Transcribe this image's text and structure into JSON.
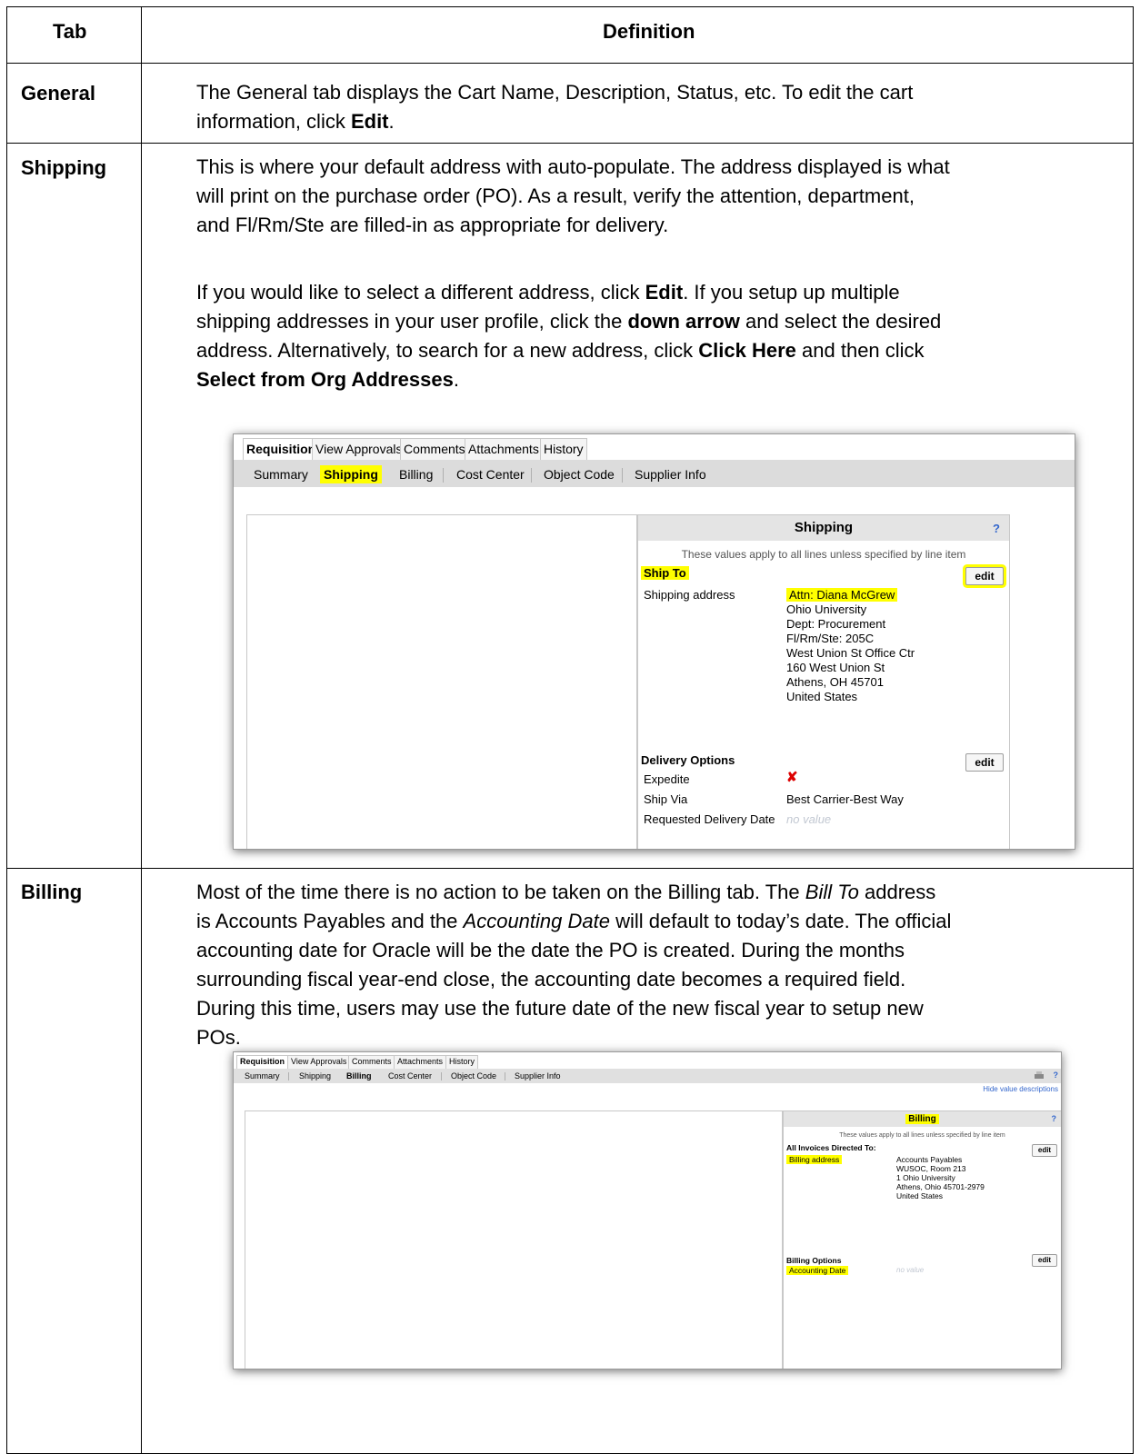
{
  "table": {
    "header_tab": "Tab",
    "header_definition": "Definition",
    "rows": {
      "general": {
        "label": "General",
        "line1": "The General tab displays the Cart Name, Description, Status, etc. To edit the cart",
        "line2_pre": "information, click ",
        "line2_bold": "Edit",
        "line2_post": "."
      },
      "shipping": {
        "label": "Shipping",
        "p1_l1": "This is where your default address with auto-populate. The address displayed is what",
        "p1_l2": "will print on the purchase order (PO). As a result, verify the attention, department,",
        "p1_l3": "and Fl/Rm/Ste are filled-in as appropriate for delivery.",
        "p2_l1_pre": "If you would like to select a different address, click ",
        "p2_l1_b": "Edit",
        "p2_l1_post": ". If you setup up multiple",
        "p2_l2_pre": "shipping addresses in your user profile, click the ",
        "p2_l2_b": "down arrow",
        "p2_l2_post": " and select the desired",
        "p2_l3_pre": "address. Alternatively, to search for a new address, click ",
        "p2_l3_b": "Click Here",
        "p2_l3_post": " and then click",
        "p2_l4_b": "Select from Org Addresses",
        "p2_l4_post": "."
      },
      "billing": {
        "label": "Billing",
        "l1_pre": "Most of the time there is no action to be taken on the Billing tab. The ",
        "l1_i": "Bill To",
        "l1_post": " address",
        "l2_pre": "is Accounts Payables and the ",
        "l2_i": "Accounting Date",
        "l2_post": " will default to today’s date. The official",
        "l3": "accounting date for Oracle will be the date the PO is created. During the months",
        "l4": "surrounding fiscal year-end close, the accounting date becomes a required field.",
        "l5": "During this time, users may use the future date of the new fiscal year to setup new",
        "l6": "POs."
      }
    }
  },
  "screenshot_shipping": {
    "top_tabs": [
      "Requisition",
      "View Approvals",
      "Comments",
      "Attachments",
      "History"
    ],
    "sub_tabs": [
      "Summary",
      "Shipping",
      "Billing",
      "Cost Center",
      "Object Code",
      "Supplier Info"
    ],
    "panel_title": "Shipping",
    "help": "?",
    "note": "These values apply to all lines unless specified by line item",
    "ship_to": "Ship To",
    "shipping_address_label": "Shipping address",
    "address_lines": [
      "Attn: Diana McGrew",
      "Ohio University",
      "Dept: Procurement",
      "Fl/Rm/Ste: 205C",
      "West Union St Office Ctr",
      "160 West Union St",
      "Athens, OH 45701",
      "United States"
    ],
    "edit": "edit",
    "delivery_options": "Delivery Options",
    "expedite": "Expedite",
    "expedite_value": "✘",
    "ship_via": "Ship Via",
    "ship_via_value": "Best Carrier-Best Way",
    "requested_delivery_date": "Requested Delivery Date",
    "no_value": "no value"
  },
  "screenshot_billing": {
    "top_tabs": [
      "Requisition",
      "View Approvals",
      "Comments",
      "Attachments",
      "History"
    ],
    "sub_tabs": [
      "Summary",
      "Shipping",
      "Billing",
      "Cost Center",
      "Object Code",
      "Supplier Info"
    ],
    "hide_link": "Hide value descriptions",
    "panel_title": "Billing",
    "help": "?",
    "note": "These values apply to all lines unless specified by line item",
    "invoices": "All Invoices Directed To:",
    "billing_address_label": "Billing address",
    "address_lines": [
      "Accounts Payables",
      "WUSOC, Room 213",
      "1 Ohio University",
      "Athens, Ohio 45701-2979",
      "United States"
    ],
    "edit": "edit",
    "billing_options": "Billing Options",
    "accounting_date": "Accounting Date",
    "no_value": "no value"
  }
}
